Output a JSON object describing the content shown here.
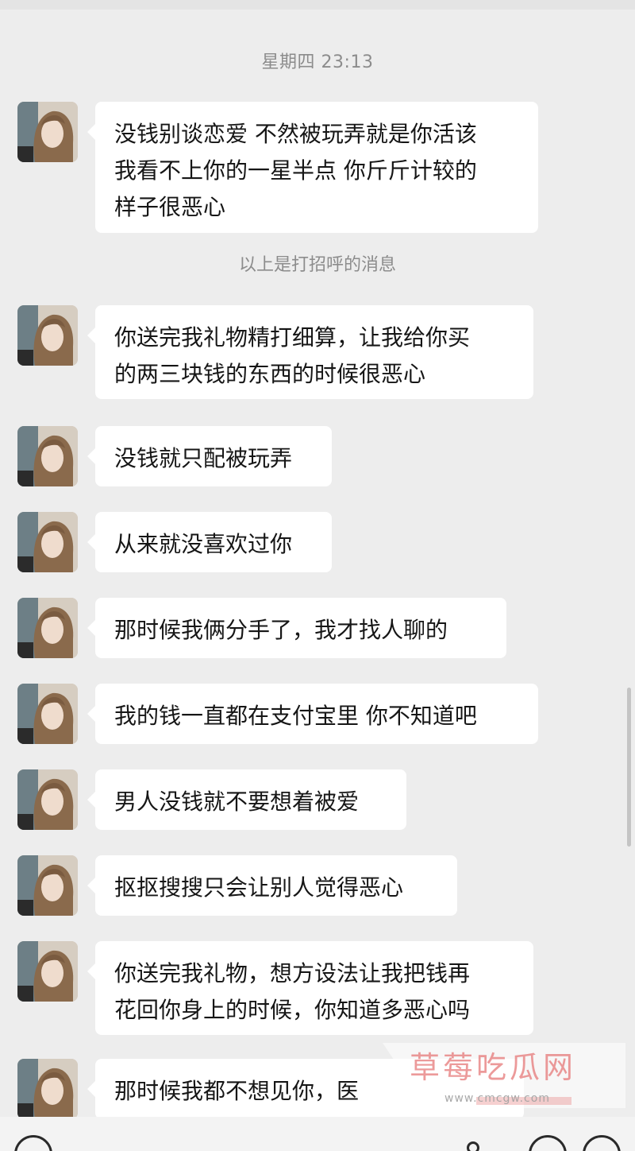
{
  "chat": {
    "timestamp": "星期四 23:13",
    "system_note": "以上是打招呼的消息",
    "messages": [
      {
        "text": "没钱别谈恋爱 不然被玩弄就是你活该\n我看不上你的一星半点 你斤斤计较的\n样子很恶心"
      },
      {
        "text": "你送完我礼物精打细算，让我给你买\n的两三块钱的东西的时候很恶心"
      },
      {
        "text": "没钱就只配被玩弄"
      },
      {
        "text": "从来就没喜欢过你"
      },
      {
        "text": "那时候我俩分手了，我才找人聊的"
      },
      {
        "text": "我的钱一直都在支付宝里 你不知道吧"
      },
      {
        "text": "男人没钱就不要想着被爱"
      },
      {
        "text": "抠抠搜搜只会让别人觉得恶心"
      },
      {
        "text": "你送完我礼物，想方设法让我把钱再\n花回你身上的时候，你知道多恶心吗"
      },
      {
        "text": "那时候我都不想见你，医"
      }
    ]
  },
  "watermark": {
    "title": "草莓吃瓜网",
    "url": "www.cmcgw.com"
  },
  "icons": {
    "avatar": "avatar-photo",
    "voice": "voice-icon",
    "emoji": "emoji-icon",
    "plus": "plus-icon"
  }
}
